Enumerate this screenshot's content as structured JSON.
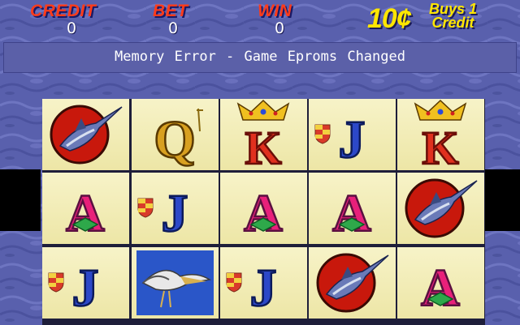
{
  "hud": {
    "credit_label": "CREDIT",
    "credit_value": "0",
    "bet_label": "BET",
    "bet_value": "0",
    "win_label": "WIN",
    "win_value": "0",
    "price": "10¢",
    "buys_line1": "Buys 1",
    "buys_line2": "Credit"
  },
  "message": "Memory Error - Game Eproms Changed",
  "colors": {
    "hud_label": "#ff3b1a",
    "price": "#ffe600",
    "background": "#5a63b0"
  },
  "reels": [
    [
      "marlin-icon",
      "ace-icon",
      "jack-icon"
    ],
    [
      "queen-icon",
      "jack-icon",
      "pelican-icon"
    ],
    [
      "king-icon",
      "ace-icon",
      "jack-icon"
    ],
    [
      "jack-icon",
      "ace-icon",
      "marlin-icon"
    ],
    [
      "king-icon",
      "marlin-icon",
      "ace-icon"
    ]
  ],
  "letters": {
    "ace": "A",
    "king": "K",
    "queen": "Q",
    "jack": "J"
  }
}
